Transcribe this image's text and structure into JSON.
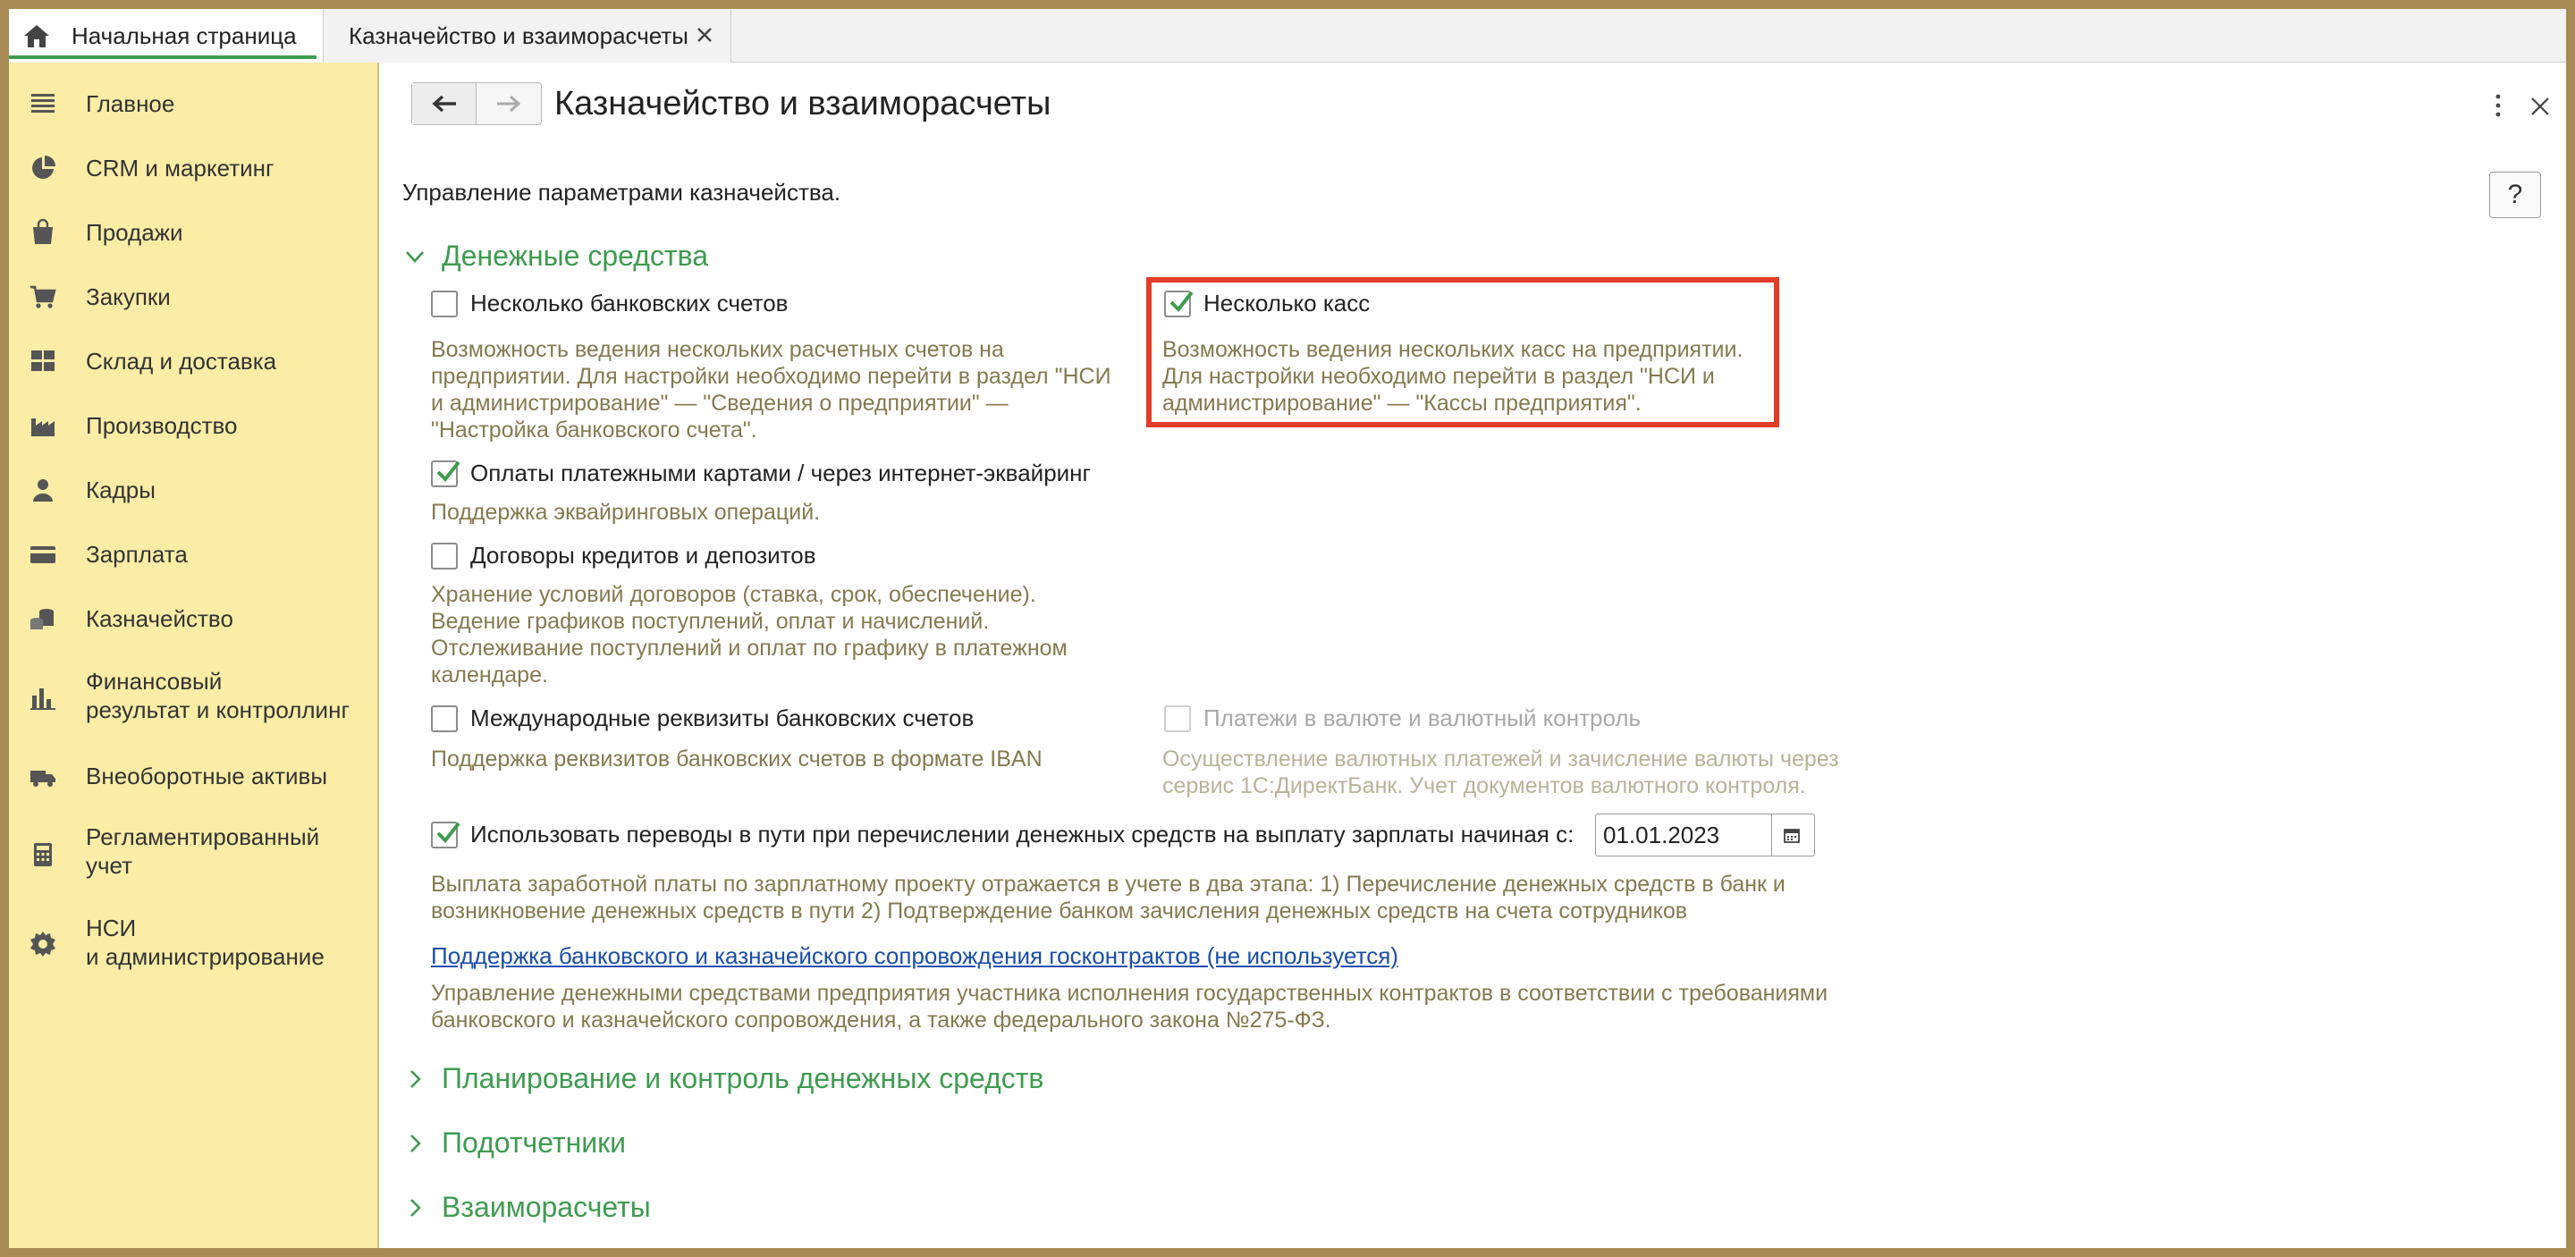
{
  "tabs": [
    {
      "label": "Начальная страница",
      "active": true
    },
    {
      "label": "Казначейство и взаиморасчеты",
      "active": false
    }
  ],
  "sidebar": {
    "items": [
      {
        "label": "Главное",
        "icon": "menu-icon"
      },
      {
        "label": "CRM и маркетинг",
        "icon": "pie-chart-icon"
      },
      {
        "label": "Продажи",
        "icon": "shopping-bag-icon"
      },
      {
        "label": "Закупки",
        "icon": "cart-icon"
      },
      {
        "label": "Склад и доставка",
        "icon": "warehouse-grid-icon"
      },
      {
        "label": "Производство",
        "icon": "factory-icon"
      },
      {
        "label": "Кадры",
        "icon": "person-icon"
      },
      {
        "label": "Зарплата",
        "icon": "card-icon"
      },
      {
        "label": "Казначейство",
        "icon": "coins-icon"
      },
      {
        "label": "Финансовый",
        "label2": "результат и контроллинг",
        "icon": "bar-chart-icon"
      },
      {
        "label": "Внеоборотные активы",
        "icon": "truck-icon"
      },
      {
        "label": "Регламентированный",
        "label2": "учет",
        "icon": "calculator-icon"
      },
      {
        "label": "НСИ",
        "label2": "и администрирование",
        "icon": "gear-icon"
      }
    ]
  },
  "header": {
    "title": "Казначейство и взаиморасчеты",
    "help": "?"
  },
  "subtitle": "Управление параметрами казначейства.",
  "sections": {
    "money": "Денежные средства",
    "planning": "Планирование и контроль денежных средств",
    "accountable": "Подотчетники",
    "settlements": "Взаиморасчеты"
  },
  "options": {
    "bank_accounts": {
      "label": "Несколько банковских счетов",
      "checked": false,
      "desc": [
        "Возможность ведения нескольких расчетных счетов на",
        "предприятии. Для настройки необходимо перейти в раздел \"НСИ",
        "и администрирование\" — \"Сведения о предприятии\" —",
        "\"Настройка банковского счета\"."
      ]
    },
    "cash_desks": {
      "label": "Несколько касс",
      "checked": true,
      "desc": [
        "Возможность ведения нескольких касс на предприятии.",
        "Для настройки необходимо перейти в раздел \"НСИ и",
        "администрирование\" — \"Кассы предприятия\"."
      ]
    },
    "card_payments": {
      "label": "Оплаты платежными картами / через интернет-эквайринг",
      "checked": true,
      "desc": [
        "Поддержка эквайринговых операций."
      ]
    },
    "credit_contracts": {
      "label": "Договоры кредитов и депозитов",
      "checked": false,
      "desc": [
        "Хранение условий договоров (ставка, срок, обеспечение).",
        "Ведение графиков поступлений, оплат и начислений.",
        "Отслеживание поступлений и оплат по графику в платежном",
        "календаре."
      ]
    },
    "iban": {
      "label": "Международные реквизиты банковских счетов",
      "checked": false,
      "desc": [
        "Поддержка реквизитов банковских счетов в формате IBAN"
      ]
    },
    "currency": {
      "label": "Платежи в валюте и валютный контроль",
      "checked": false,
      "disabled": true,
      "desc": [
        "Осуществление валютных платежей и зачисление валюты через",
        "сервис 1С:ДиректБанк. Учет документов валютного контроля."
      ]
    },
    "transit": {
      "label": "Использовать переводы в пути при перечислении денежных средств на выплату зарплаты начиная с:",
      "checked": true,
      "date": "01.01.2023",
      "desc": [
        "Выплата заработной платы по зарплатному проекту отражается в учете в два этапа: 1) Перечисление денежных средств в банк и",
        "возникновение денежных средств в пути 2) Подтверждение банком зачисления денежных средств на счета сотрудников"
      ]
    }
  },
  "gov_link": {
    "label": "Поддержка банковского и казначейского сопровождения госконтрактов (не используется)",
    "desc": [
      "Управление денежными средствами предприятия участника исполнения государственных контрактов в соответствии с требованиями",
      "банковского и казначейского сопровождения, а также федерального закона №275-ФЗ."
    ]
  },
  "colors": {
    "accent_green": "#3E9B4F",
    "sidebar_bg": "#FBEDA6",
    "desc_text": "#847A50",
    "highlight": "#E23D2A",
    "link": "#1A4DAA"
  }
}
